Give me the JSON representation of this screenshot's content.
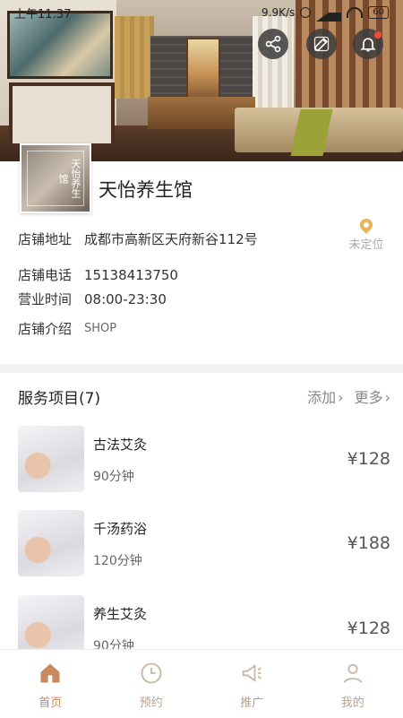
{
  "status_bar": {
    "time": "上午11:37",
    "speed": "9.9K/s",
    "battery": "60"
  },
  "store": {
    "name": "天怡养生馆",
    "logo_text": "天怡养生馆",
    "address_label": "店铺地址",
    "address": "成都市高新区天府新谷112号",
    "location_status": "未定位",
    "phone_label": "店铺电话",
    "phone": "15138413750",
    "hours_label": "营业时间",
    "hours": "08:00-23:30",
    "intro_label": "店铺介绍",
    "intro": "SHOP"
  },
  "services": {
    "title": "服务项目(7)",
    "add_label": "添加",
    "more_label": "更多",
    "items": [
      {
        "name": "古法艾灸",
        "duration": "90分钟",
        "price": "¥128"
      },
      {
        "name": "千汤药浴",
        "duration": "120分钟",
        "price": "¥188"
      },
      {
        "name": "养生艾灸",
        "duration": "90分钟",
        "price": "¥128"
      }
    ]
  },
  "bottom_nav": [
    {
      "label": "首页",
      "icon": "home-icon",
      "active": true
    },
    {
      "label": "预约",
      "icon": "clock-icon",
      "active": false
    },
    {
      "label": "推广",
      "icon": "megaphone-icon",
      "active": false
    },
    {
      "label": "我的",
      "icon": "user-icon",
      "active": false
    }
  ],
  "colors": {
    "accent": "#c98a5e",
    "nav_inactive": "#b8a28d",
    "pin": "#e6b45a",
    "badge": "#f04a3a"
  }
}
